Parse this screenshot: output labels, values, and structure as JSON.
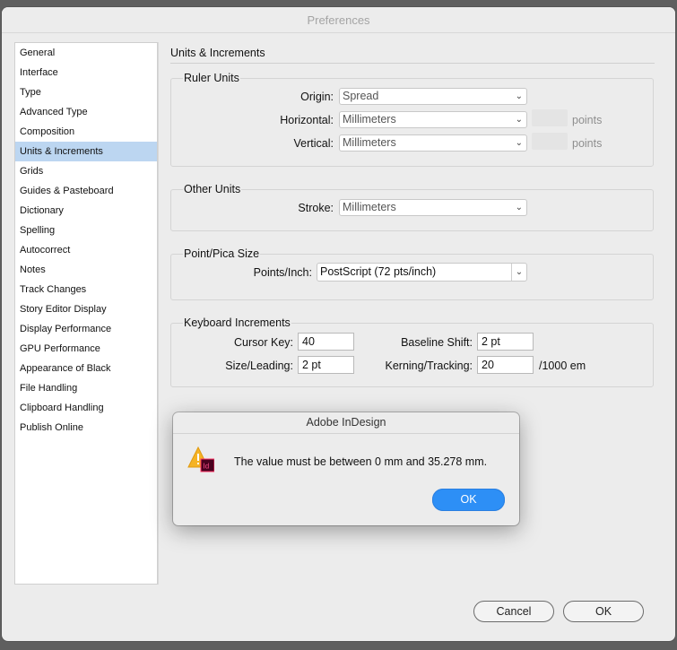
{
  "window": {
    "title": "Preferences"
  },
  "sidebar": {
    "items": [
      {
        "label": "General"
      },
      {
        "label": "Interface"
      },
      {
        "label": "Type"
      },
      {
        "label": "Advanced Type"
      },
      {
        "label": "Composition"
      },
      {
        "label": "Units & Increments",
        "selected": true
      },
      {
        "label": "Grids"
      },
      {
        "label": "Guides & Pasteboard"
      },
      {
        "label": "Dictionary"
      },
      {
        "label": "Spelling"
      },
      {
        "label": "Autocorrect"
      },
      {
        "label": "Notes"
      },
      {
        "label": "Track Changes"
      },
      {
        "label": "Story Editor Display"
      },
      {
        "label": "Display Performance"
      },
      {
        "label": "GPU Performance"
      },
      {
        "label": "Appearance of Black"
      },
      {
        "label": "File Handling"
      },
      {
        "label": "Clipboard Handling"
      },
      {
        "label": "Publish Online"
      }
    ]
  },
  "main": {
    "title": "Units & Increments",
    "ruler_units": {
      "title": "Ruler Units",
      "origin_label": "Origin:",
      "origin_value": "Spread",
      "horizontal_label": "Horizontal:",
      "horizontal_value": "Millimeters",
      "horizontal_unit": "points",
      "vertical_label": "Vertical:",
      "vertical_value": "Millimeters",
      "vertical_unit": "points"
    },
    "other_units": {
      "title": "Other Units",
      "stroke_label": "Stroke:",
      "stroke_value": "Millimeters"
    },
    "point_pica": {
      "title": "Point/Pica Size",
      "points_label": "Points/Inch:",
      "points_value": "PostScript (72 pts/inch)"
    },
    "keyboard": {
      "title": "Keyboard Increments",
      "cursor_label": "Cursor Key:",
      "cursor_value": "40",
      "baseline_label": "Baseline Shift:",
      "baseline_value": "2 pt",
      "size_label": "Size/Leading:",
      "size_value": "2 pt",
      "kerning_label": "Kerning/Tracking:",
      "kerning_value": "20",
      "kerning_suffix": "/1000 em"
    }
  },
  "footer": {
    "cancel_label": "Cancel",
    "ok_label": "OK"
  },
  "alert": {
    "title": "Adobe InDesign",
    "message": "The value must be between 0 mm and 35.278 mm.",
    "ok_label": "OK",
    "icon_text": "Id"
  },
  "colors": {
    "accent": "#2d8ff6",
    "selection": "#bcd6f1",
    "warning": "#f5b324",
    "indesign": "#49021f"
  }
}
